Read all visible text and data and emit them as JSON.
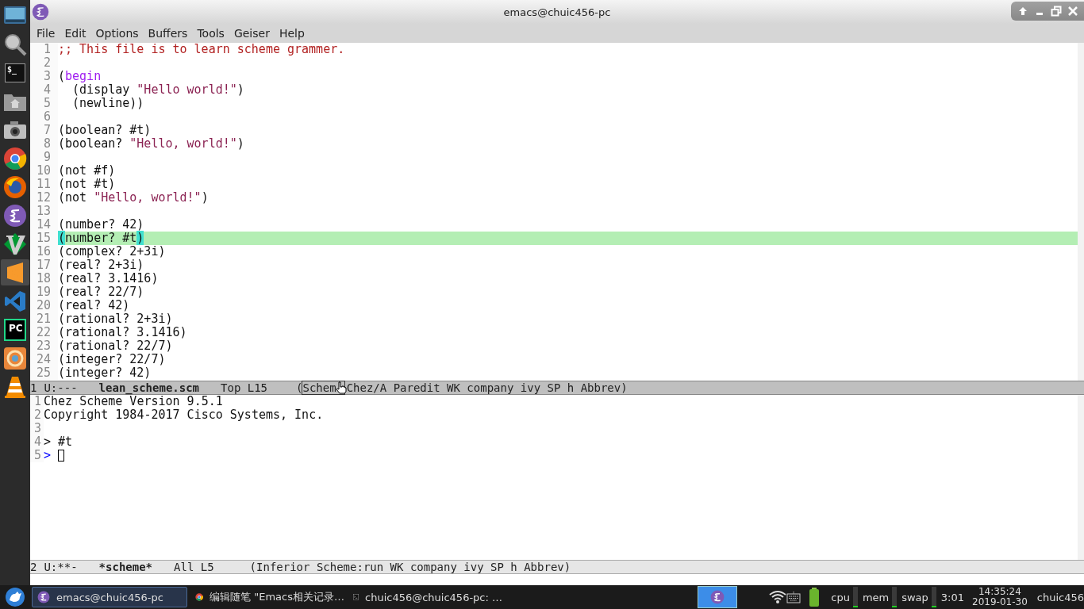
{
  "window": {
    "title": "emacs@chuic456-pc"
  },
  "dock": [
    {
      "kind": "monitor",
      "selected": false
    },
    {
      "kind": "search",
      "selected": false
    },
    {
      "kind": "terminal",
      "selected": false,
      "label": "$_"
    },
    {
      "kind": "folder",
      "selected": false
    },
    {
      "kind": "camera",
      "selected": false
    },
    {
      "kind": "chrome",
      "selected": false
    },
    {
      "kind": "firefox",
      "selected": false
    },
    {
      "kind": "emacs",
      "selected": false
    },
    {
      "kind": "vim",
      "selected": false
    },
    {
      "kind": "sublime",
      "selected": true
    },
    {
      "kind": "vscode",
      "selected": false
    },
    {
      "kind": "pycharm",
      "selected": false,
      "label": "PC"
    },
    {
      "kind": "swirl",
      "selected": false
    },
    {
      "kind": "vlc",
      "selected": false
    }
  ],
  "menu": [
    "File",
    "Edit",
    "Options",
    "Buffers",
    "Tools",
    "Geiser",
    "Help"
  ],
  "editor": {
    "lines": [
      {
        "number": "1",
        "current": false,
        "segments": [
          {
            "kind": "comment",
            "text": ";; This file is to learn scheme grammer."
          }
        ]
      },
      {
        "number": "2",
        "current": false
      },
      {
        "number": "3",
        "current": false,
        "segments": [
          {
            "kind": "plain",
            "text": "("
          },
          {
            "kind": "keyword",
            "text": "begin"
          }
        ]
      },
      {
        "number": "4",
        "current": false,
        "segments": [
          {
            "kind": "plain",
            "text": "  (display "
          },
          {
            "kind": "string",
            "text": "\"Hello world!\""
          },
          {
            "kind": "plain",
            "text": ")"
          }
        ]
      },
      {
        "number": "5",
        "current": false,
        "segments": [
          {
            "kind": "plain",
            "text": "  (newline))"
          }
        ]
      },
      {
        "number": "6",
        "current": false
      },
      {
        "number": "7",
        "current": false,
        "segments": [
          {
            "kind": "plain",
            "text": "(boolean? #t)"
          }
        ]
      },
      {
        "number": "8",
        "current": false,
        "segments": [
          {
            "kind": "plain",
            "text": "(boolean? "
          },
          {
            "kind": "string",
            "text": "\"Hello, world!\""
          },
          {
            "kind": "plain",
            "text": ")"
          }
        ]
      },
      {
        "number": "9",
        "current": false
      },
      {
        "number": "10",
        "current": false,
        "segments": [
          {
            "kind": "plain",
            "text": "(not #f)"
          }
        ]
      },
      {
        "number": "11",
        "current": false,
        "segments": [
          {
            "kind": "plain",
            "text": "(not #t)"
          }
        ]
      },
      {
        "number": "12",
        "current": false,
        "segments": [
          {
            "kind": "plain",
            "text": "(not "
          },
          {
            "kind": "string",
            "text": "\"Hello, world!\""
          },
          {
            "kind": "plain",
            "text": ")"
          }
        ]
      },
      {
        "number": "13",
        "current": false
      },
      {
        "number": "14",
        "current": false,
        "segments": [
          {
            "kind": "plain",
            "text": "(number? 42)"
          }
        ]
      },
      {
        "number": "15",
        "current": true,
        "segments": [
          {
            "kind": "paren-match",
            "text": "("
          },
          {
            "kind": "plain",
            "text": "number? #t"
          },
          {
            "kind": "paren-match",
            "text": ")"
          }
        ]
      },
      {
        "number": "16",
        "current": false,
        "segments": [
          {
            "kind": "plain",
            "text": "(complex? 2+3i)"
          }
        ]
      },
      {
        "number": "17",
        "current": false,
        "segments": [
          {
            "kind": "plain",
            "text": "(real? 2+3i)"
          }
        ]
      },
      {
        "number": "18",
        "current": false,
        "segments": [
          {
            "kind": "plain",
            "text": "(real? 3.1416)"
          }
        ]
      },
      {
        "number": "19",
        "current": false,
        "segments": [
          {
            "kind": "plain",
            "text": "(real? 22/7)"
          }
        ]
      },
      {
        "number": "20",
        "current": false,
        "segments": [
          {
            "kind": "plain",
            "text": "(real? 42)"
          }
        ]
      },
      {
        "number": "21",
        "current": false,
        "segments": [
          {
            "kind": "plain",
            "text": "(rational? 2+3i)"
          }
        ]
      },
      {
        "number": "22",
        "current": false,
        "segments": [
          {
            "kind": "plain",
            "text": "(rational? 3.1416)"
          }
        ]
      },
      {
        "number": "23",
        "current": false,
        "segments": [
          {
            "kind": "plain",
            "text": "(rational? 22/7)"
          }
        ]
      },
      {
        "number": "24",
        "current": false,
        "segments": [
          {
            "kind": "plain",
            "text": "(integer? 22/7)"
          }
        ]
      },
      {
        "number": "25",
        "current": false,
        "segments": [
          {
            "kind": "plain",
            "text": "(integer? 42)"
          }
        ]
      }
    ],
    "mode_line": {
      "active": true,
      "window": "1",
      "state": "U:---",
      "buffer": "lean_scheme.scm",
      "position": "Top L15",
      "open": "(",
      "major_mode": "Schem",
      "minor_modes": "Chez/A Paredit WK company ivy SP h Abbrev)"
    }
  },
  "repl": {
    "lines": [
      {
        "number": "1",
        "segments": [
          {
            "kind": "plain",
            "text": "Chez Scheme Version 9.5.1"
          }
        ]
      },
      {
        "number": "2",
        "segments": [
          {
            "kind": "plain",
            "text": "Copyright 1984-2017 Cisco Systems, Inc."
          }
        ]
      },
      {
        "number": "3"
      },
      {
        "number": "4",
        "segments": [
          {
            "kind": "plain",
            "text": "> #t"
          }
        ]
      },
      {
        "number": "5",
        "segments": [
          {
            "kind": "prompt",
            "text": ">"
          },
          {
            "kind": "cursor"
          }
        ]
      }
    ],
    "mode_line": {
      "active": false,
      "window": "2",
      "state": "U:**-",
      "buffer": "*scheme*",
      "position": "All L5",
      "open": "(",
      "major_mode": "Inferior Scheme:run",
      "minor_modes": "WK company ivy SP h Abbrev)"
    }
  },
  "taskbar": {
    "tasks": [
      {
        "kind": "emacs",
        "label": "emacs@chuic456-pc",
        "selected": true
      },
      {
        "kind": "chrome",
        "label": "编辑随笔 \"Emacs相关记录…",
        "selected": false
      },
      {
        "kind": "terminal",
        "label": "chuic456@chuic456-pc: …",
        "selected": false
      }
    ],
    "meters": [
      "cpu",
      "mem",
      "swap"
    ],
    "battery_time": "3:01",
    "time": "14:35:24",
    "date": "2019-01-30",
    "user": "chuic456"
  }
}
